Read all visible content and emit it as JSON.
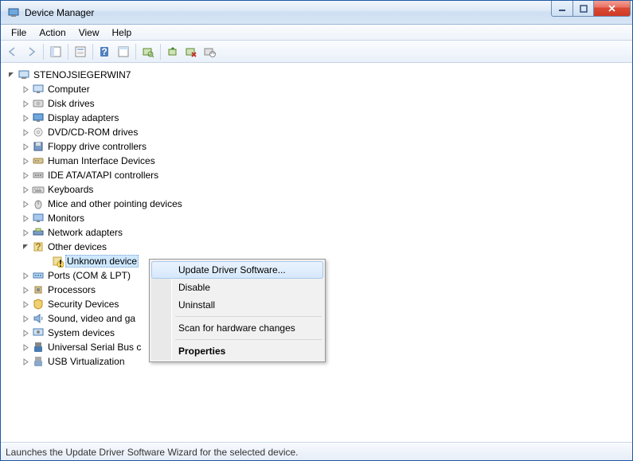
{
  "window": {
    "title": "Device Manager"
  },
  "menubar": {
    "items": [
      "File",
      "Action",
      "View",
      "Help"
    ]
  },
  "toolbar": {
    "items": [
      "back",
      "forward",
      "sep",
      "show-hide-tree",
      "sep",
      "properties",
      "sep",
      "help",
      "sep",
      "refresh",
      "sep",
      "scan-hardware",
      "sep",
      "update-driver",
      "uninstall",
      "disable"
    ]
  },
  "tree": {
    "root": "STENOJSIEGERWIN7",
    "nodes": [
      {
        "label": "Computer",
        "icon": "computer"
      },
      {
        "label": "Disk drives",
        "icon": "disk"
      },
      {
        "label": "Display adapters",
        "icon": "display"
      },
      {
        "label": "DVD/CD-ROM drives",
        "icon": "dvd"
      },
      {
        "label": "Floppy drive controllers",
        "icon": "floppy"
      },
      {
        "label": "Human Interface Devices",
        "icon": "hid"
      },
      {
        "label": "IDE ATA/ATAPI controllers",
        "icon": "ide"
      },
      {
        "label": "Keyboards",
        "icon": "keyboard"
      },
      {
        "label": "Mice and other pointing devices",
        "icon": "mouse"
      },
      {
        "label": "Monitors",
        "icon": "monitor"
      },
      {
        "label": "Network adapters",
        "icon": "network"
      },
      {
        "label": "Other devices",
        "icon": "other",
        "expanded": true,
        "children": [
          {
            "label": "Unknown device",
            "icon": "unknown",
            "selected": true
          }
        ]
      },
      {
        "label": "Ports (COM & LPT)",
        "icon": "port"
      },
      {
        "label": "Processors",
        "icon": "cpu"
      },
      {
        "label": "Security Devices",
        "icon": "security"
      },
      {
        "label": "Sound, video and game controllers",
        "icon": "sound",
        "truncated": "Sound, video and ga"
      },
      {
        "label": "System devices",
        "icon": "system"
      },
      {
        "label": "Universal Serial Bus controllers",
        "icon": "usb",
        "truncated": "Universal Serial Bus c"
      },
      {
        "label": "USB Virtualization",
        "icon": "usbv"
      }
    ]
  },
  "context_menu": {
    "items": [
      {
        "label": "Update Driver Software...",
        "highlight": true
      },
      {
        "label": "Disable"
      },
      {
        "label": "Uninstall"
      },
      {
        "sep": true
      },
      {
        "label": "Scan for hardware changes"
      },
      {
        "sep": true
      },
      {
        "label": "Properties",
        "bold": true
      }
    ]
  },
  "statusbar": {
    "text": "Launches the Update Driver Software Wizard for the selected device."
  }
}
